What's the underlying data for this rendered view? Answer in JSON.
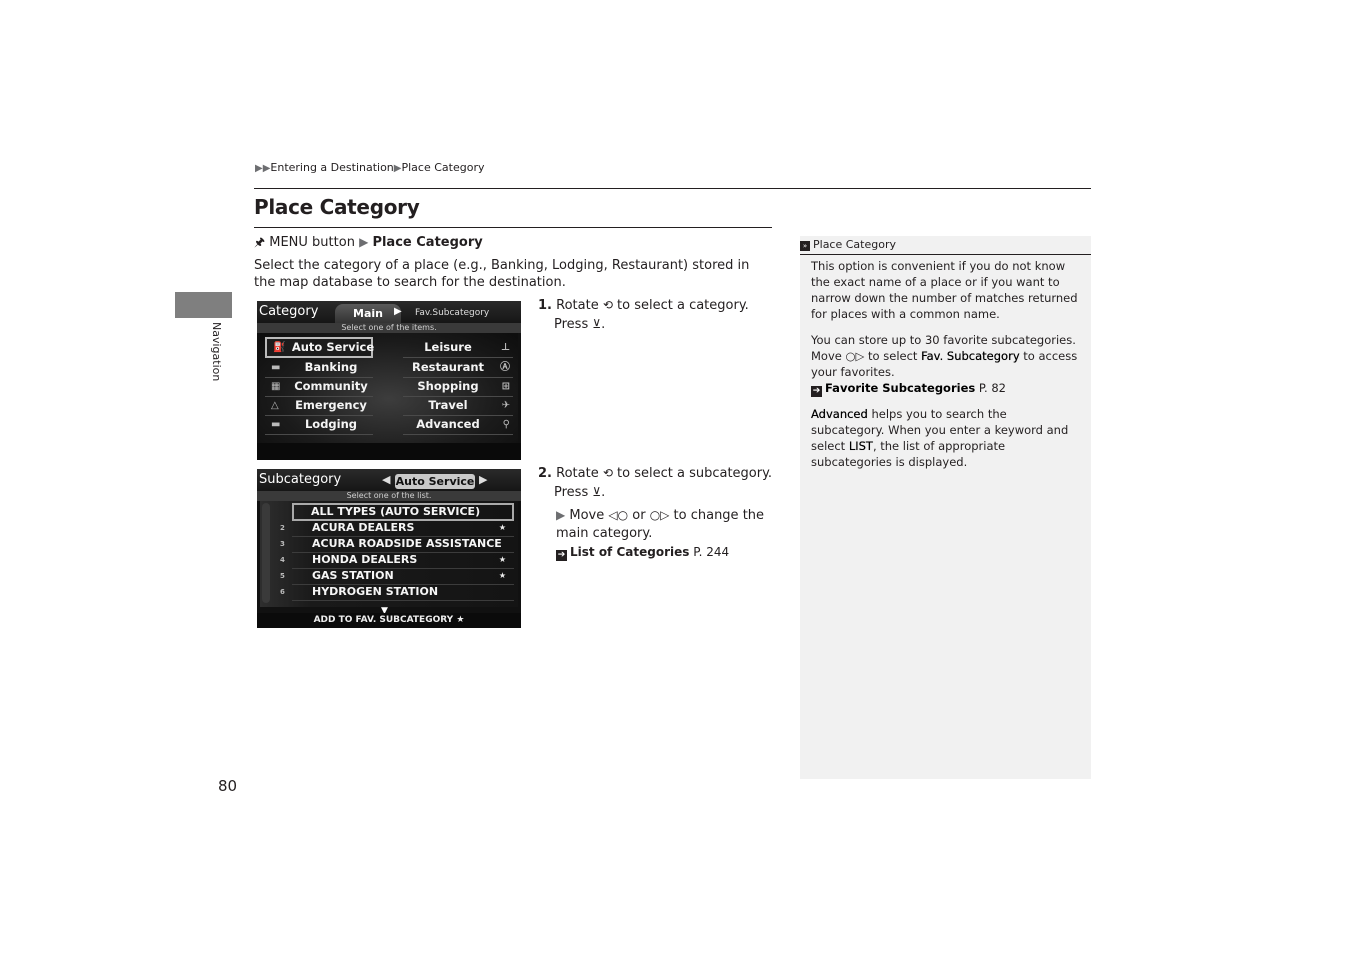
{
  "breadcrumb": {
    "prefix_icon": "double-triangle-right-icon",
    "items": [
      "Entering a Destination",
      "Place Category"
    ]
  },
  "page_title": "Place Category",
  "menu_path": {
    "icon": "menu-button-icon",
    "start": "MENU button",
    "target": "Place Category"
  },
  "intro": "Select the category of a place (e.g., Banking, Lodging, Restaurant) stored in the map database to search for the destination.",
  "side_tab": {
    "label": "Navigation"
  },
  "screen_category": {
    "title": "Category",
    "tabs": {
      "main": "Main",
      "fav": "Fav.Subcategory"
    },
    "hint": "Select one of the items.",
    "left_items": [
      {
        "label": "Auto Service",
        "icon": "fuel-pump-icon",
        "glyph": "⛽",
        "selected": true
      },
      {
        "label": "Banking",
        "icon": "money-icon",
        "glyph": "▬"
      },
      {
        "label": "Community",
        "icon": "building-icon",
        "glyph": "▦"
      },
      {
        "label": "Emergency",
        "icon": "warning-triangle-icon",
        "glyph": "△"
      },
      {
        "label": "Lodging",
        "icon": "bed-icon",
        "glyph": "▬"
      }
    ],
    "right_items": [
      {
        "label": "Leisure",
        "icon": "leisure-icon",
        "glyph": "⊥"
      },
      {
        "label": "Restaurant",
        "icon": "restaurant-icon",
        "glyph": "Ⓐ"
      },
      {
        "label": "Shopping",
        "icon": "cart-icon",
        "glyph": "⊞"
      },
      {
        "label": "Travel",
        "icon": "airplane-icon",
        "glyph": "✈"
      },
      {
        "label": "Advanced",
        "icon": "magnifier-icon",
        "glyph": "⚲"
      }
    ]
  },
  "screen_subcategory": {
    "title": "Subcategory",
    "selected_category": "Auto Service",
    "hint": "Select one of the list.",
    "items": [
      {
        "num": "",
        "label": "ALL TYPES (AUTO SERVICE)",
        "star": ""
      },
      {
        "num": "2",
        "label": "ACURA DEALERS",
        "star": "★"
      },
      {
        "num": "3",
        "label": "ACURA ROADSIDE ASSISTANCE",
        "star": ""
      },
      {
        "num": "4",
        "label": "HONDA DEALERS",
        "star": "★"
      },
      {
        "num": "5",
        "label": "GAS STATION",
        "star": "★"
      },
      {
        "num": "6",
        "label": "HYDROGEN STATION",
        "star": ""
      }
    ],
    "footer": "ADD TO FAV. SUBCATEGORY ★"
  },
  "steps": [
    {
      "num": "1.",
      "text_a": "Rotate",
      "text_b": "to select a category.",
      "press": "Press"
    },
    {
      "num": "2.",
      "text_a": "Rotate",
      "text_b": "to select a subcategory.",
      "press": "Press"
    }
  ],
  "step2_note": {
    "text_a": "Move",
    "or": "or",
    "text_b": "to change the main category.",
    "ref_label": "List of Categories",
    "ref_page": "P. 244"
  },
  "sidebar_note": {
    "header": "Place Category",
    "p1": "This option is convenient if you do not know the exact name of a place or if you want to narrow down the number of matches returned for places with a common name.",
    "p2_a": "You can store up to 30 favorite subcategories. Move",
    "p2_b": "to select",
    "p2_bold": "Fav. Subcategory",
    "p2_c": "to access your favorites.",
    "p2_ref_label": "Favorite Subcategories",
    "p2_ref_page": "P. 82",
    "p3_bold": "Advanced",
    "p3_a": "helps you to search the subcategory. When you enter a keyword and select",
    "p3_bold2": "LIST",
    "p3_b": ", the list of appropriate subcategories is displayed."
  },
  "page_number": "80"
}
